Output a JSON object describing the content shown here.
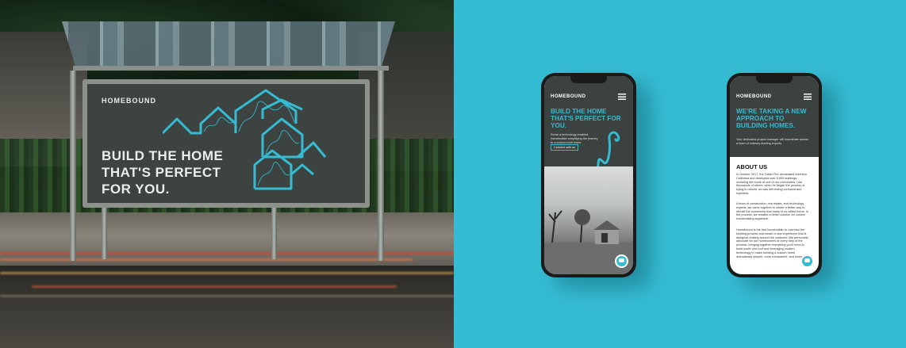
{
  "billboard": {
    "logo": "HOMEBOUND",
    "headline_lines": [
      "BUILD THE HOME",
      "THAT'S PERFECT",
      "FOR YOU."
    ]
  },
  "phone1": {
    "logo": "HOMEBOUND",
    "menu_icon": "hamburger-icon",
    "headline": "BUILD THE HOME THAT'S PERFECT FOR YOU.",
    "subtext": "Some a technology-enabled homebuilder simplifying the journey to a custom built home.",
    "cta_label": "Connect with us",
    "chat_icon": "chat-bubble-icon"
  },
  "phone2": {
    "logo": "HOMEBOUND",
    "menu_icon": "hamburger-icon",
    "headline": "WE'RE TAKING A NEW APPROACH TO BUILDING HOMES.",
    "subtext": "Your dedicated project manager will coordinate across a team of industry-leading experts.",
    "about_title": "ABOUT US",
    "about_paragraphs": [
      "In October 2017, the Tubbs Fire devastated Northern California and destroyed over 5,600 buildings, including the home of one of our cofounders. Like thousands of others, when he began the process of trying to rebuild, he was left feeling confused and hopeless.",
      "A team of construction, real estate, and technology experts, we came together to create a better way to rebuild the community that many of us called home. In the process, we created a better solution for custom homebuilding anywhere.",
      "Homebound is the first homebuilder to overhaul the building process and create a new experience that is designed entirely around the customer. We personally advocate for our homeowners at every step of the process, bringing together everything you'll need to build under one roof and leveraging modern technology to make building a custom home dramatically simpler, more transparent, and human."
    ],
    "chat_icon": "chat-bubble-icon"
  },
  "colors": {
    "accent_teal": "#35bcd3",
    "brand_dark": "#3c4240",
    "billboard_panel": "#3d4341"
  }
}
